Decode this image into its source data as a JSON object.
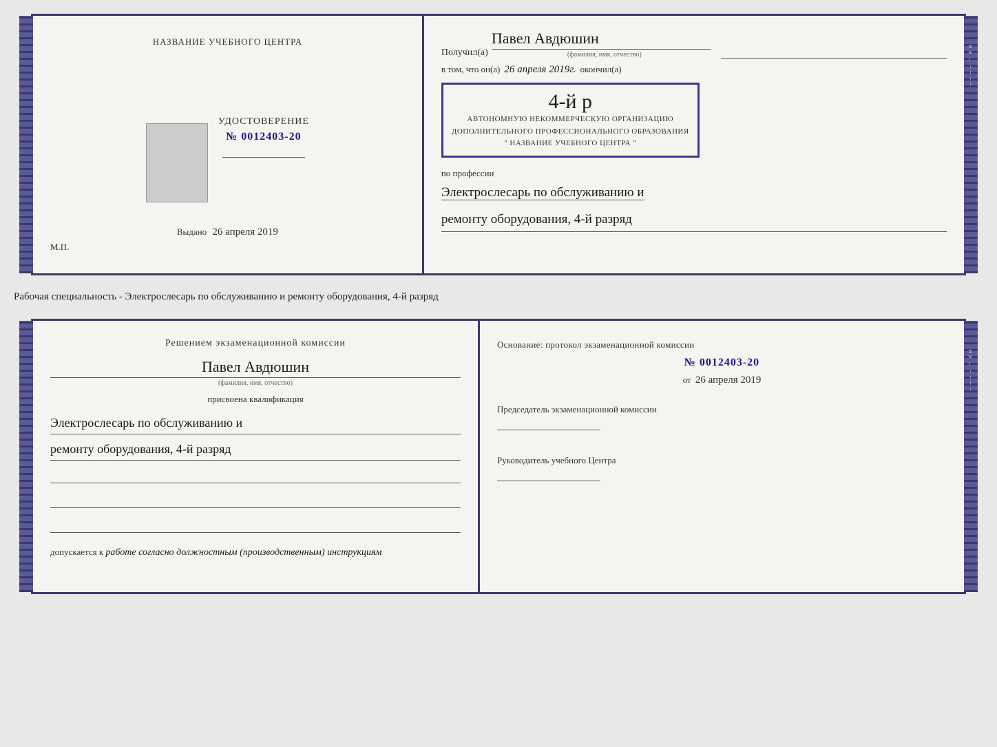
{
  "top_doc": {
    "left": {
      "title": "НАЗВАНИЕ УЧЕБНОГО ЦЕНТРА",
      "cert_label": "УДОСТОВЕРЕНИЕ",
      "cert_number": "№ 0012403-20",
      "issued_label": "Выдано",
      "issued_date": "26 апреля 2019",
      "mp_label": "М.П."
    },
    "right": {
      "poluchil_label": "Получил(а)",
      "recipient_name": "Павел Авдюшин",
      "fio_sub": "(фамилия, имя, отчество)",
      "vtom_label": "в том, что он(а)",
      "vtom_date": "26 апреля 2019г.",
      "okonchil_label": "окончил(а)",
      "rank_large": "4-й р",
      "org_line1": "АВТОНОМНУЮ НЕКОММЕРЧЕСКУЮ ОРГАНИЗАЦИЮ",
      "org_line2": "ДОПОЛНИТЕЛЬНОГО ПРОФЕССИОНАЛЬНОГО ОБРАЗОВАНИЯ",
      "org_line3": "\" НАЗВАНИЕ УЧЕБНОГО ЦЕНТРА \"",
      "po_professii_label": "по профессии",
      "profession_line1": "Электрослесарь по обслуживанию и",
      "profession_line2": "ремонту оборудования, 4-й разряд"
    }
  },
  "middle_text": "Рабочая специальность - Электрослесарь по обслуживанию и ремонту оборудования, 4-й разряд",
  "bottom_doc": {
    "left": {
      "decision_title": "Решением экзаменационной комиссии",
      "person_name": "Павел Авдюшин",
      "fio_sub": "(фамилия, имя, отчество)",
      "prisvoena_label": "присвоена квалификация",
      "qualification_line1": "Электрослесарь по обслуживанию и",
      "qualification_line2": "ремонту оборудования, 4-й разряд",
      "dopuskaetsya_label": "допускается к",
      "dopuskaetsya_value": "работе согласно должностным (производственным) инструкциям"
    },
    "right": {
      "osnovaniye_label": "Основание: протокол экзаменационной  комиссии",
      "protokol_number": "№  0012403-20",
      "ot_label": "от",
      "ot_date": "26 апреля 2019",
      "chairman_title": "Председатель экзаменационной комиссии",
      "rukovoditel_title": "Руководитель учебного Центра"
    }
  },
  "side_chars": [
    "и",
    "а",
    "←",
    "–",
    "–",
    "–",
    "–"
  ]
}
